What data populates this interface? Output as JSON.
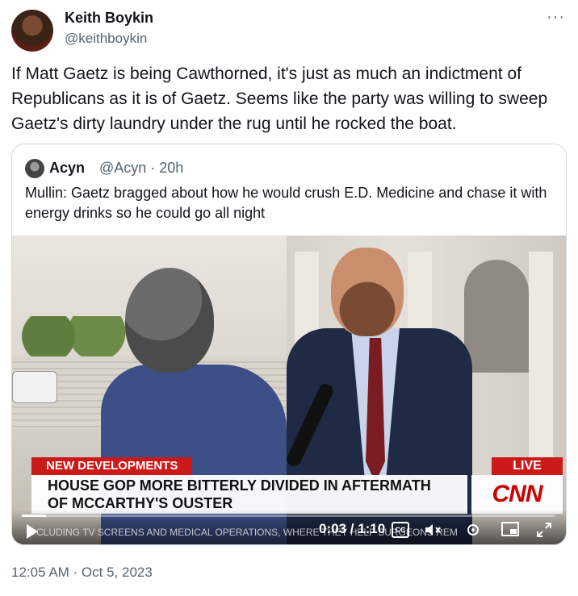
{
  "author": {
    "name": "Keith Boykin",
    "handle": "@keithboykin"
  },
  "more_label": "···",
  "tweet_text": "If Matt Gaetz is being Cawthorned, it's just as much an indictment of Republicans as it is of Gaetz. Seems like the party was willing to sweep Gaetz's dirty laundry under the rug until he rocked the boat.",
  "quoted": {
    "name": "Acyn",
    "meta": "@Acyn · 20h",
    "text": "Mullin: Gaetz bragged about how he would crush E.D. Medicine and chase it with energy drinks so he could go all night"
  },
  "video": {
    "banner_label": "NEW DEVELOPMENTS",
    "live_label": "LIVE",
    "headline": "HOUSE GOP MORE BITTERLY DIVIDED IN AFTERMATH OF MCCARTHY'S OUSTER",
    "network": "CNN",
    "ticker": "CLUDING TV SCREENS AND MEDICAL OPERATIONS, WHERE THEY HELP SURGEONS REM",
    "time": "0:03 / 1:10",
    "progress_fraction": 0.045,
    "cc_label": "CC"
  },
  "timestamp": "12:05 AM · Oct 5, 2023"
}
